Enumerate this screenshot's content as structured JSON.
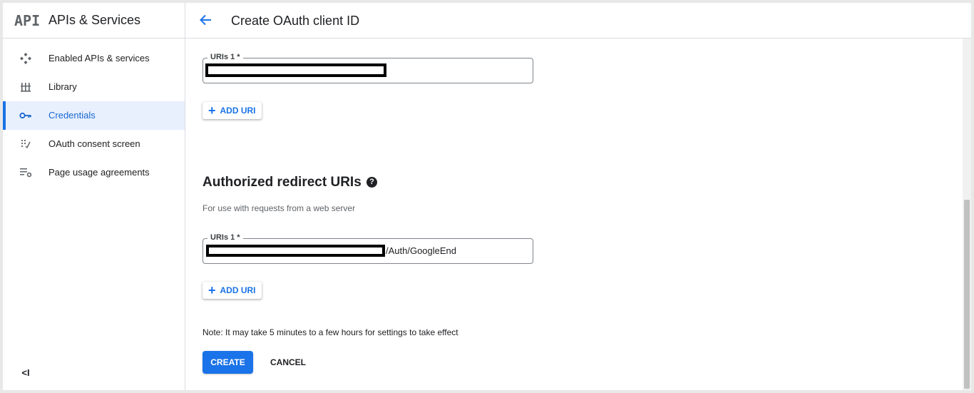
{
  "sidebar": {
    "logo": "API",
    "title": "APIs & Services",
    "items": [
      {
        "label": "Enabled APIs & services",
        "icon": "apis-icon",
        "active": false
      },
      {
        "label": "Library",
        "icon": "library-icon",
        "active": false
      },
      {
        "label": "Credentials",
        "icon": "key-icon",
        "active": true
      },
      {
        "label": "OAuth consent screen",
        "icon": "consent-icon",
        "active": false
      },
      {
        "label": "Page usage agreements",
        "icon": "settings-list-icon",
        "active": false
      }
    ],
    "collapse_label": "<I"
  },
  "header": {
    "title": "Create OAuth client ID"
  },
  "origins": {
    "field_label": "URIs 1 *",
    "field_value": "",
    "add_label": "ADD URI"
  },
  "redirects": {
    "title": "Authorized redirect URIs",
    "help": "?",
    "subtitle": "For use with requests from a web server",
    "field_label": "URIs 1 *",
    "field_value": "/Auth/GoogleEnd",
    "add_label": "ADD URI"
  },
  "footer": {
    "note": "Note: It may take 5 minutes to a few hours for settings to take effect",
    "create_label": "CREATE",
    "cancel_label": "CANCEL"
  },
  "colors": {
    "accent": "#1a73e8",
    "active_bg": "#e8f0fe"
  }
}
